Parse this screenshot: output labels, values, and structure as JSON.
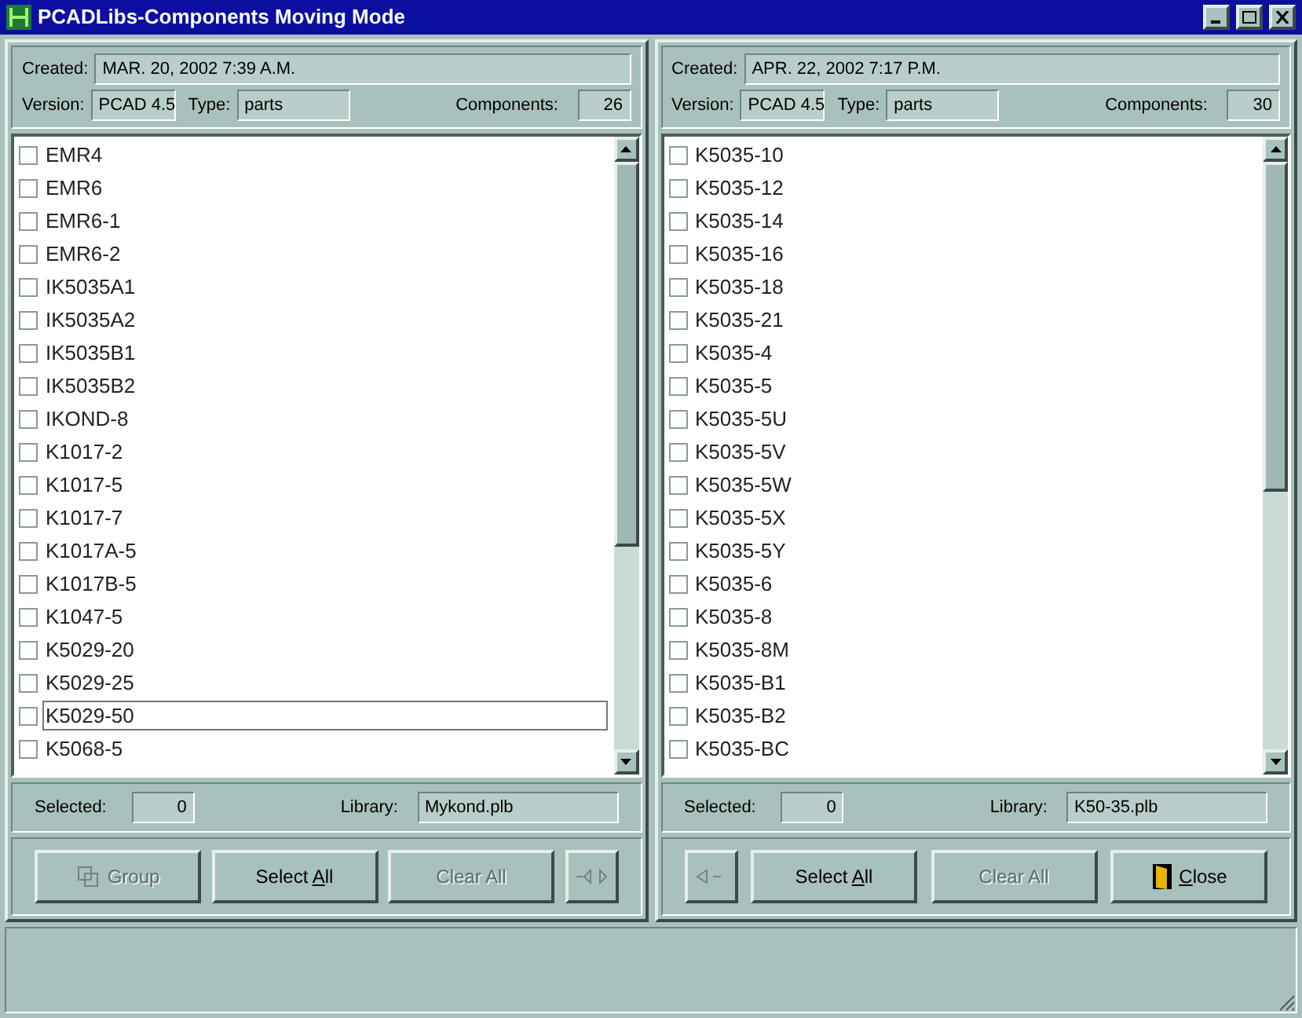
{
  "window": {
    "title": "PCADLibs-Components Moving Mode"
  },
  "panels": [
    {
      "created_label": "Created:",
      "created": "MAR. 20, 2002  7:39 A.M.",
      "version_label": "Version:",
      "version": "PCAD 4.5",
      "type_label": "Type:",
      "type": "parts",
      "components_label": "Components:",
      "components": "26",
      "items": [
        {
          "label": "EMR4",
          "checked": false,
          "focused": false
        },
        {
          "label": "EMR6",
          "checked": false,
          "focused": false
        },
        {
          "label": "EMR6-1",
          "checked": false,
          "focused": false
        },
        {
          "label": "EMR6-2",
          "checked": false,
          "focused": false
        },
        {
          "label": "IK5035A1",
          "checked": false,
          "focused": false
        },
        {
          "label": "IK5035A2",
          "checked": false,
          "focused": false
        },
        {
          "label": "IK5035B1",
          "checked": false,
          "focused": false
        },
        {
          "label": "IK5035B2",
          "checked": false,
          "focused": false
        },
        {
          "label": "IKOND-8",
          "checked": false,
          "focused": false
        },
        {
          "label": "K1017-2",
          "checked": false,
          "focused": false
        },
        {
          "label": "K1017-5",
          "checked": false,
          "focused": false
        },
        {
          "label": "K1017-7",
          "checked": false,
          "focused": false
        },
        {
          "label": "K1017A-5",
          "checked": false,
          "focused": false
        },
        {
          "label": "K1017B-5",
          "checked": false,
          "focused": false
        },
        {
          "label": "K1047-5",
          "checked": false,
          "focused": false
        },
        {
          "label": "K5029-20",
          "checked": false,
          "focused": false
        },
        {
          "label": "K5029-25",
          "checked": false,
          "focused": false
        },
        {
          "label": "K5029-50",
          "checked": false,
          "focused": true
        },
        {
          "label": "K5068-5",
          "checked": false,
          "focused": false
        }
      ],
      "selected_label": "Selected:",
      "selected": "0",
      "library_label": "Library:",
      "library": "Mykond.plb",
      "buttons": [
        {
          "kind": "group",
          "label_parts": {
            "before": "Group"
          },
          "disabled": true
        },
        {
          "kind": "text",
          "label_parts": {
            "before": "Select ",
            "key": "A",
            "after": "ll"
          },
          "disabled": false
        },
        {
          "kind": "text",
          "label_parts": {
            "before": "Clear All"
          },
          "disabled": true
        },
        {
          "kind": "move_right",
          "disabled": true
        }
      ]
    },
    {
      "created_label": "Created:",
      "created": "APR. 22, 2002  7:17 P.M.",
      "version_label": "Version:",
      "version": "PCAD 4.5",
      "type_label": "Type:",
      "type": "parts",
      "components_label": "Components:",
      "components": "30",
      "items": [
        {
          "label": "K5035-10",
          "checked": false,
          "focused": false
        },
        {
          "label": "K5035-12",
          "checked": false,
          "focused": false
        },
        {
          "label": "K5035-14",
          "checked": false,
          "focused": false
        },
        {
          "label": "K5035-16",
          "checked": false,
          "focused": false
        },
        {
          "label": "K5035-18",
          "checked": false,
          "focused": false
        },
        {
          "label": "K5035-21",
          "checked": false,
          "focused": false
        },
        {
          "label": "K5035-4",
          "checked": false,
          "focused": false
        },
        {
          "label": "K5035-5",
          "checked": false,
          "focused": false
        },
        {
          "label": "K5035-5U",
          "checked": false,
          "focused": false
        },
        {
          "label": "K5035-5V",
          "checked": false,
          "focused": false
        },
        {
          "label": "K5035-5W",
          "checked": false,
          "focused": false
        },
        {
          "label": "K5035-5X",
          "checked": false,
          "focused": false
        },
        {
          "label": "K5035-5Y",
          "checked": false,
          "focused": false
        },
        {
          "label": "K5035-6",
          "checked": false,
          "focused": false
        },
        {
          "label": "K5035-8",
          "checked": false,
          "focused": false
        },
        {
          "label": "K5035-8M",
          "checked": false,
          "focused": false
        },
        {
          "label": "K5035-B1",
          "checked": false,
          "focused": false
        },
        {
          "label": "K5035-B2",
          "checked": false,
          "focused": false
        },
        {
          "label": "K5035-BC",
          "checked": false,
          "focused": false
        }
      ],
      "selected_label": "Selected:",
      "selected": "0",
      "library_label": "Library:",
      "library": "K50-35.plb",
      "buttons": [
        {
          "kind": "move_left",
          "disabled": true
        },
        {
          "kind": "text",
          "label_parts": {
            "before": "Select ",
            "key": "A",
            "after": "ll"
          },
          "disabled": false
        },
        {
          "kind": "text",
          "label_parts": {
            "before": "Clear All"
          },
          "disabled": true
        },
        {
          "kind": "close",
          "label_parts": {
            "key": "C",
            "after": "lose"
          },
          "disabled": false
        }
      ]
    }
  ]
}
